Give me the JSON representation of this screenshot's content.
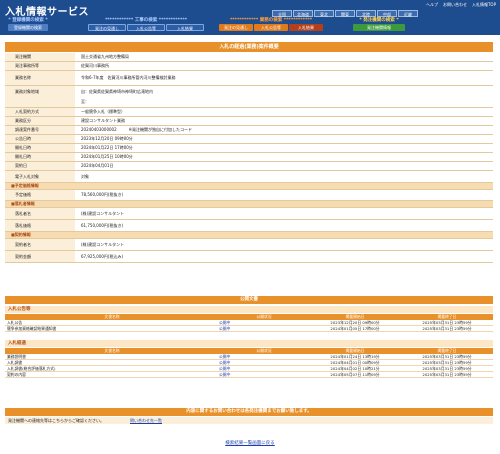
{
  "header": {
    "app_title": "入札情報サービス",
    "links": [
      "ヘルプ",
      "お問い合わせ",
      "入札情報TOP"
    ],
    "regions_row1": [
      "全国",
      "北海道",
      "東北",
      "関東",
      "北陸",
      "中部",
      "近畿"
    ],
    "regions_row2": [
      "中国",
      "四国",
      "九州・沖縄"
    ],
    "groups": [
      {
        "title": "* 登録機関の検索 *",
        "tabs": [
          "登録機関の検索"
        ]
      },
      {
        "title": "************ 工事の検索 ************",
        "tabs": [
          "発注の見通し",
          "入札公告等",
          "入札結果"
        ]
      },
      {
        "title": "************ 業務の検索 ************",
        "tabs": [
          "発注の見通し",
          "入札公告等",
          "入札結果"
        ]
      },
      {
        "title": "* 発注機関の検索 *",
        "tabs": [
          "発注機関情報"
        ]
      }
    ]
  },
  "page_title": "入札の経過(業務)案件概要",
  "details": [
    {
      "label": "発注機関",
      "value": "国土交通省九州地方整備局"
    },
    {
      "label": "発注事務所等",
      "value": "佐賀河川事務所"
    },
    {
      "label": "業務名称",
      "value": "令和6-7年度　佐賀河川事務所管内河川整備検討業務"
    },
    {
      "label": "業務対象地域",
      "value": "自：佐賀県佐賀県神埼市神埼町広滝地内"
    },
    {
      "label": "",
      "value": "至："
    },
    {
      "label": "入札契約方式",
      "value": "一般競争入札（標準型）"
    },
    {
      "label": "業務区分",
      "value": "建設コンサルタント業務"
    },
    {
      "label": "調達案件番号",
      "value": "20240403000002　　　※発注機関が独自に付加したコード"
    },
    {
      "label": "公告日時",
      "value": "2023年12月20日 09時00分"
    },
    {
      "label": "開札日時",
      "value": "2024年01月22日 17時00分"
    },
    {
      "label": "開札日時",
      "value": "2024年01月25日 10時00分"
    },
    {
      "label": "契約日",
      "value": "2024年04月01日"
    },
    {
      "label": "電子入札対象",
      "value": "対象"
    }
  ],
  "sections": {
    "yotei": {
      "title": "■予定価格情報",
      "rows": [
        {
          "label": "予定価格",
          "value": "78,560,000円(税抜き)"
        }
      ]
    },
    "rakusatsu": {
      "title": "■落札者情報",
      "rows": [
        {
          "label": "落札者名",
          "value": "(株)建設コンサルタント"
        },
        {
          "label": "落札価格",
          "value": "61,750,000円(税抜き)"
        }
      ]
    },
    "keiyaku": {
      "title": "■契約情報",
      "rows": [
        {
          "label": "契約者名",
          "value": "(株)建設コンサルタント"
        },
        {
          "label": "契約金額",
          "value": "67,925,000円(税込み)"
        }
      ]
    }
  },
  "docs_title": "公開文書",
  "docs_koukoku": {
    "title": "入札公告等",
    "headers": [
      "文書名称",
      "公開状況",
      "掲載開始日",
      "掲載終了日"
    ],
    "rows": [
      {
        "name": "入札公告",
        "status": "公開中",
        "start": "2023年12月20日 09時00分",
        "end": "2025年03月31日 23時59分"
      },
      {
        "name": "競争参加資格確認結果通知書",
        "status": "公開中",
        "start": "2024年01月05日 17時00分",
        "end": "2025年03月31日 23時59分"
      }
    ]
  },
  "docs_keika": {
    "title": "入札経過",
    "headers": [
      "文書名称",
      "公開状況",
      "掲載開始日",
      "掲載終了日"
    ],
    "rows": [
      {
        "name": "業務説明書",
        "status": "公開中",
        "start": "2024年01月24日 13時19分",
        "end": "2025年03月31日 23時59分"
      },
      {
        "name": "入札調書",
        "status": "公開中",
        "start": "2024年04月01日 00時09分",
        "end": "2025年03月31日 23時59分"
      },
      {
        "name": "入札調書(総合評価落札方式)",
        "status": "公開中",
        "start": "2024年04月02日 10時21分",
        "end": "2025年03月31日 23時59分"
      },
      {
        "name": "契約の内容",
        "status": "公開中",
        "start": "2024年05月07日 11時09分",
        "end": "2025年03月31日 23時59分"
      }
    ]
  },
  "contact": {
    "title": "内容に関するお問い合わせは各発注機関までお願い致します。",
    "text": "発注機関への連絡先等はこちらからご確認ください。",
    "link": "問い合わせ先一覧"
  },
  "back_link": "検索結果一覧画面に戻る"
}
